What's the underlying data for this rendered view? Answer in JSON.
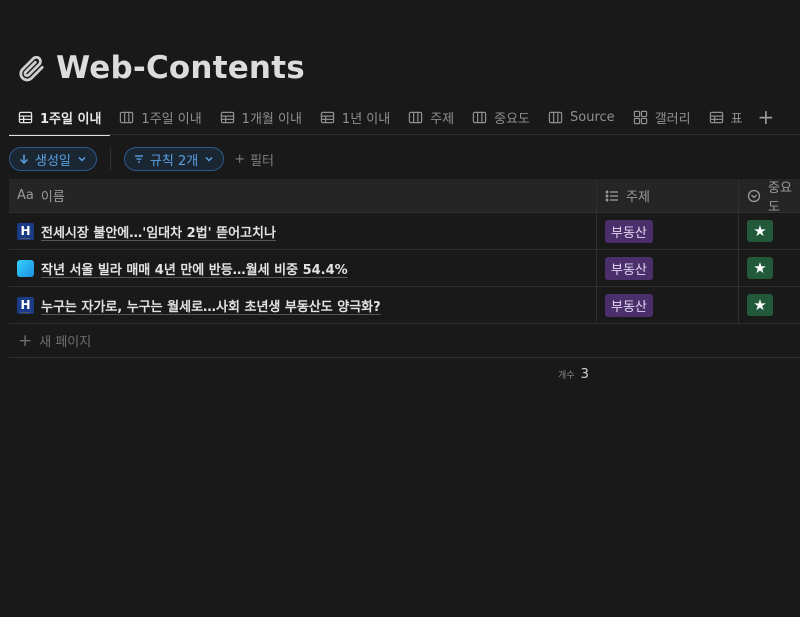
{
  "page": {
    "title": "Web-Contents",
    "icon": "paperclip-icon"
  },
  "tabs": [
    {
      "label": "1주일 이내",
      "icon": "table-icon",
      "active": true
    },
    {
      "label": "1주일 이내",
      "icon": "board-icon",
      "active": false
    },
    {
      "label": "1개월 이내",
      "icon": "table-icon",
      "active": false
    },
    {
      "label": "1년 이내",
      "icon": "table-icon",
      "active": false
    },
    {
      "label": "주제",
      "icon": "board-icon",
      "active": false
    },
    {
      "label": "중요도",
      "icon": "board-icon",
      "active": false
    },
    {
      "label": "Source",
      "icon": "board-icon",
      "active": false
    },
    {
      "label": "갤러리",
      "icon": "gallery-icon",
      "active": false
    },
    {
      "label": "표",
      "icon": "table-icon",
      "active": false
    }
  ],
  "filters": {
    "sort_label": "생성일",
    "rules_label": "규칙 2개",
    "add_filter_label": "필터"
  },
  "table": {
    "columns": {
      "name": "이름",
      "name_prefix": "Aa",
      "topic": "주제",
      "importance": "중요도"
    },
    "rows": [
      {
        "favicon": "H",
        "title": "전세시장 불안에…'임대차 2법' 뜯어고치나",
        "topic": "부동산",
        "importance": "★"
      },
      {
        "favicon": "news",
        "title": "작년 서울 빌라 매매 4년 만에 반등…월세 비중 54.4%",
        "topic": "부동산",
        "importance": "★"
      },
      {
        "favicon": "H",
        "title": "누구는 자가로, 누구는 월세로…사회 초년생 부동산도 양극화?",
        "topic": "부동산",
        "importance": "★"
      }
    ],
    "new_page_label": "새 페이지",
    "count_label": "개수",
    "count_value": "3"
  }
}
